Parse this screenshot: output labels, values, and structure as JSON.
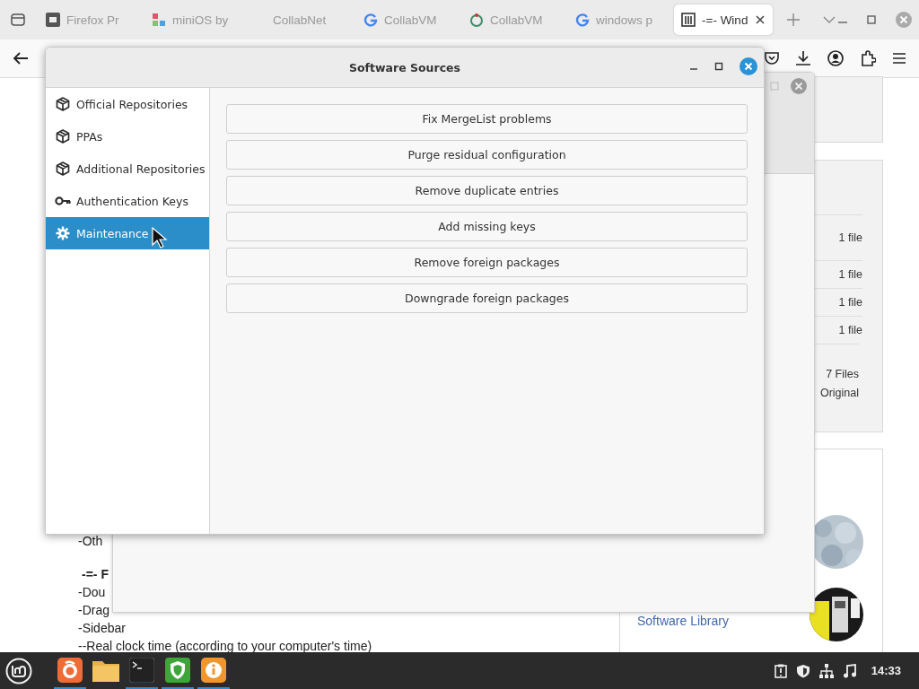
{
  "browser": {
    "tabs": [
      {
        "label": "Firefox Pr",
        "selected": false
      },
      {
        "label": "miniOS by",
        "selected": false
      },
      {
        "label": "CollabNet",
        "selected": false
      },
      {
        "label": "CollabVM",
        "selected": false
      },
      {
        "label": "CollabVM",
        "selected": false
      },
      {
        "label": "windows p",
        "selected": false
      },
      {
        "label": "-=- Wind",
        "selected": true
      }
    ]
  },
  "page": {
    "file_counts": [
      "1 file",
      "1 file",
      "1 file",
      "1 file"
    ],
    "totals": [
      "7 Files",
      "Original"
    ],
    "text_lines": [
      {
        "text": "-Oth",
        "bold": false
      },
      {
        "text": "-=- F",
        "bold": true
      },
      {
        "text": "-Dou",
        "bold": false
      },
      {
        "text": "-Drag",
        "bold": false
      },
      {
        "text": "-Sidebar",
        "bold": false
      },
      {
        "text": "--Real clock time (according to your computer's time)",
        "bold": false
      }
    ],
    "link": "Software Library"
  },
  "dialog": {
    "title": "Software Sources",
    "sidebar": [
      {
        "label": "Official Repositories",
        "kind": "package",
        "selected": false
      },
      {
        "label": "PPAs",
        "kind": "package",
        "selected": false
      },
      {
        "label": "Additional Repositories",
        "kind": "package",
        "selected": false
      },
      {
        "label": "Authentication Keys",
        "kind": "key",
        "selected": false
      },
      {
        "label": "Maintenance",
        "kind": "gear",
        "selected": true
      }
    ],
    "buttons": [
      "Fix MergeList problems",
      "Purge residual configuration",
      "Remove duplicate entries",
      "Add missing keys",
      "Remove foreign packages",
      "Downgrade foreign packages"
    ]
  },
  "taskbar": {
    "apps": [
      {
        "kind": "firefox",
        "running": true
      },
      {
        "kind": "files",
        "running": false
      },
      {
        "kind": "terminal",
        "running": true
      },
      {
        "kind": "shield",
        "running": true
      },
      {
        "kind": "info",
        "running": true
      }
    ],
    "clock": "14:33"
  }
}
